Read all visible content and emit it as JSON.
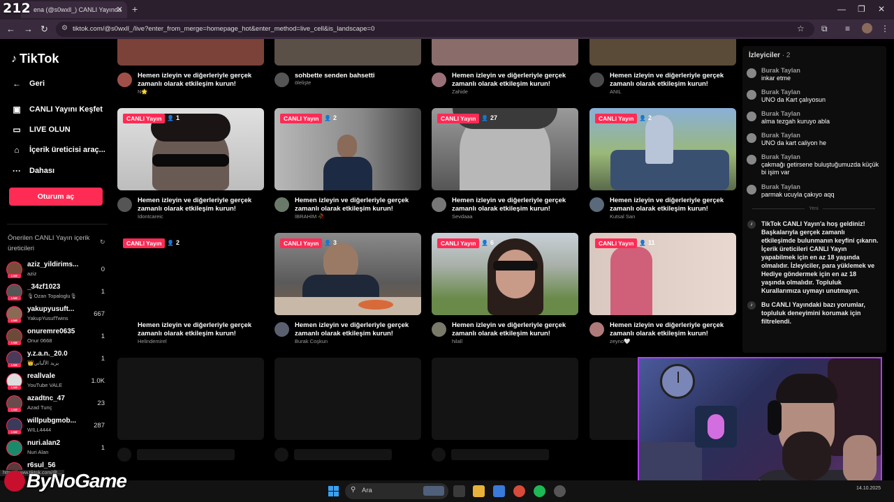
{
  "overlay_number": "212",
  "browser": {
    "tab_title": "ena (@s0wxll_) CANLI Yayında",
    "url": "tiktok.com/@s0wxll_/live?enter_from_merge=homepage_hot&enter_method=live_cell&is_landscape=0",
    "status_url": "https://www.tiktok.com/@..."
  },
  "sidebar": {
    "logo": "TikTok",
    "back": "Geri",
    "nav": [
      {
        "label": "CANLI Yayını Keşfet",
        "icon": "tv-icon"
      },
      {
        "label": "LIVE OLUN",
        "icon": "camera-icon"
      },
      {
        "label": "İçerik üreticisi araç...",
        "icon": "home-icon"
      },
      {
        "label": "Dahası",
        "icon": "more-icon"
      }
    ],
    "login": "Oturum aç",
    "suggested_title": "Önerilen CANLI Yayın içerik üreticileri",
    "suggested": [
      {
        "name": "aziz_yildirims...",
        "sub": "aziz",
        "count": "0",
        "color": "#7a4b3a"
      },
      {
        "name": "_34zf1023",
        "sub": "🎙Ozan Topaloglu🎙",
        "count": "1",
        "color": "#555"
      },
      {
        "name": "yakupyusuft...",
        "sub": "YakupYusufTwins",
        "count": "667",
        "color": "#8a6a55"
      },
      {
        "name": "onuremre0635",
        "sub": "Onur 0668",
        "count": "1",
        "color": "#6b4a3a"
      },
      {
        "name": "y.z.a.n._20.0",
        "sub": "👑يزيد الألباني",
        "count": "1",
        "color": "#4a3a5a"
      },
      {
        "name": "reallvale",
        "sub": "YouTube VALE",
        "count": "1.0K",
        "color": "#ddd"
      },
      {
        "name": "azadtnc_47",
        "sub": "Azad Tunç",
        "count": "23",
        "color": "#6a4a4a"
      },
      {
        "name": "willpubgmob...",
        "sub": "WILL4444",
        "count": "287",
        "color": "#3a3a5a"
      },
      {
        "name": "nuri.alan2",
        "sub": "Nuri Alan",
        "count": "1",
        "color": "#1a8a6a"
      },
      {
        "name": "r6sul_56",
        "sub": "",
        "count": "",
        "color": "#5a3a3a"
      }
    ]
  },
  "cards_top": [
    {
      "title": "Hemen izleyin ve diğerleriyle gerçek zamanlı olarak etkileşim kurun!",
      "user": "N🌟",
      "color": "#7a4238"
    },
    {
      "title": "sohbette senden bahsetti",
      "user": "ölelişte",
      "color": "#5a5048"
    },
    {
      "title": "Hemen izleyin ve diğerleriyle gerçek zamanlı olarak etkileşim kurun!",
      "user": "Zahide",
      "color": "#8a6c6a"
    },
    {
      "title": "Hemen izleyin ve diğerleriyle gerçek zamanlı olarak etkileşim kurun!",
      "user": "ANIL",
      "color": "#5a4a38"
    }
  ],
  "cards_row1": [
    {
      "badge": "CANLI Yayın",
      "viewers": "1",
      "title": "Hemen izleyin ve diğerleriyle gerçek zamanlı olarak etkileşim kurun!",
      "user": "İdontcareic",
      "color": "#c9c9c9"
    },
    {
      "badge": "CANLI Yayın",
      "viewers": "2",
      "title": "Hemen izleyin ve diğerleriyle gerçek zamanlı olarak etkileşim kurun!",
      "user": "İBRAHİM 🥀",
      "color": "#8a8a88"
    },
    {
      "badge": "CANLI Yayın",
      "viewers": "27",
      "title": "Hemen izleyin ve diğerleriyle gerçek zamanlı olarak etkileşim kurun!",
      "user": "Sevdaaa",
      "color": "#9a9a9a"
    },
    {
      "badge": "CANLI Yayın",
      "viewers": "2",
      "title": "Hemen izleyin ve diğerleriyle gerçek zamanlı olarak etkileşim kurun!",
      "user": "Kutsal San",
      "color": "#6a8aa8"
    }
  ],
  "cards_row2": [
    {
      "badge": "CANLI Yayın",
      "viewers": "2",
      "title": "Hemen izleyin ve diğerleriyle gerçek zamanlı olarak etkileşim kurun!",
      "user": "Helindemirel",
      "color": "#000000"
    },
    {
      "badge": "CANLI Yayın",
      "viewers": "3",
      "title": "Hemen izleyin ve diğerleriyle gerçek zamanlı olarak etkileşim kurun!",
      "user": "Burak Coşkun",
      "color": "#6a7078"
    },
    {
      "badge": "CANLI Yayın",
      "viewers": "6",
      "title": "Hemen izleyin ve diğerleriyle gerçek zamanlı olarak etkileşim kurun!",
      "user": "hilall",
      "color": "#7a8a6a"
    },
    {
      "badge": "CANLI Yayın",
      "viewers": "11",
      "title": "Hemen izleyin ve diğerleriyle gerçek zamanlı olarak etkileşim kurun!",
      "user": "zeyno🤍",
      "color": "#c28a8a"
    }
  ],
  "chat": {
    "header": "İzleyiciler",
    "count": "· 2",
    "messages": [
      {
        "name": "Burak Taylan",
        "text": "inkar etme"
      },
      {
        "name": "Burak Taylan",
        "text": "UNO da Kart çalıyosun"
      },
      {
        "name": "Burak Taylan",
        "text": "alma tezgah kuruyo abla"
      },
      {
        "name": "Burak Taylan",
        "text": "UNO da kart caliyon he"
      },
      {
        "name": "Burak Taylan",
        "text": "çakmağı getirsene buluştuğumuzda küçük bi işim var"
      },
      {
        "name": "Burak Taylan",
        "text": "parmak ucuyla çakıyo aqq"
      }
    ],
    "new_label": "Yeni",
    "system": [
      "TikTok CANLI Yayın'a hoş geldiniz! Başkalarıyla gerçek zamanlı etkileşimde bulunmanın keyfini çıkarın. İçerik üreticileri CANLI Yayın yapabilmek için en az 18 yaşında olmalıdır. İzleyiciler, para yüklemek ve Hediye göndermek için en az 18 yaşında olmalıdır. Topluluk Kurallarımıza uymayı unutmayın.",
      "Bu CANLI Yayındaki bazı yorumlar, topluluk deneyimini korumak için filtrelendi."
    ]
  },
  "taskbar": {
    "search": "Ara",
    "clock": "14.10.2025"
  },
  "watermark": "ByNoGame"
}
